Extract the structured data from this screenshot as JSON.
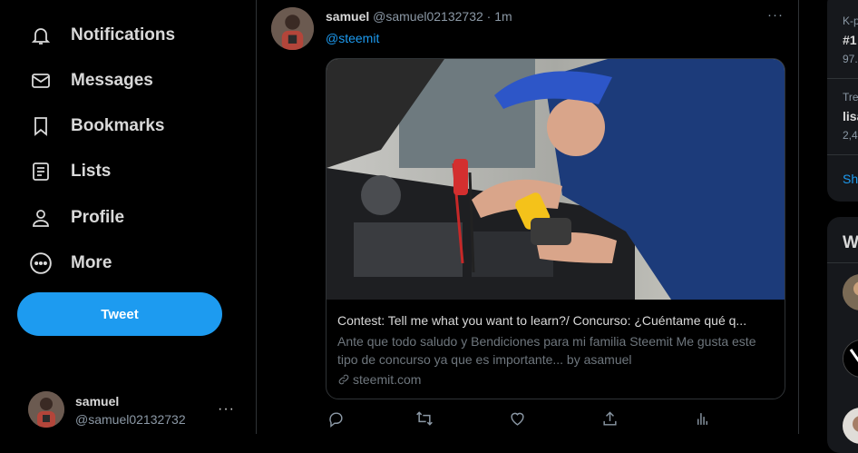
{
  "nav": {
    "items": [
      {
        "label": "Notifications",
        "icon": "bell-icon"
      },
      {
        "label": "Messages",
        "icon": "envelope-icon"
      },
      {
        "label": "Bookmarks",
        "icon": "bookmark-icon"
      },
      {
        "label": "Lists",
        "icon": "list-icon"
      },
      {
        "label": "Profile",
        "icon": "person-icon"
      },
      {
        "label": "More",
        "icon": "more-circle-icon"
      }
    ],
    "tweet_button": "Tweet"
  },
  "account": {
    "name": "samuel",
    "handle": "@samuel02132732",
    "more": "···"
  },
  "tweet": {
    "author_name": "samuel",
    "author_handle": "@samuel02132732",
    "separator": "·",
    "time": "1m",
    "more": "···",
    "mention": "@steemit",
    "card": {
      "title": "Contest: Tell me what you want to learn?/ Concurso: ¿Cuéntame qué q...",
      "description": "Ante que todo saludo y Bendiciones para mi familia Steemit Me gusta este tipo de concurso ya que es importante... by asamuel",
      "domain": "steemit.com"
    },
    "actions": [
      "reply-icon",
      "retweet-icon",
      "like-icon",
      "share-icon",
      "analytics-icon"
    ]
  },
  "right": {
    "trend1_cat": "K-p",
    "trend1_name": "#1",
    "trend1_count": "97.",
    "trend2_cat": "Tre",
    "trend2_name": "lisa",
    "trend2_count": "2,4",
    "show_more": "Sh",
    "who_heading": "W"
  },
  "colors": {
    "accent": "#1d9bf0",
    "background": "#000000",
    "panel": "#16181c"
  }
}
